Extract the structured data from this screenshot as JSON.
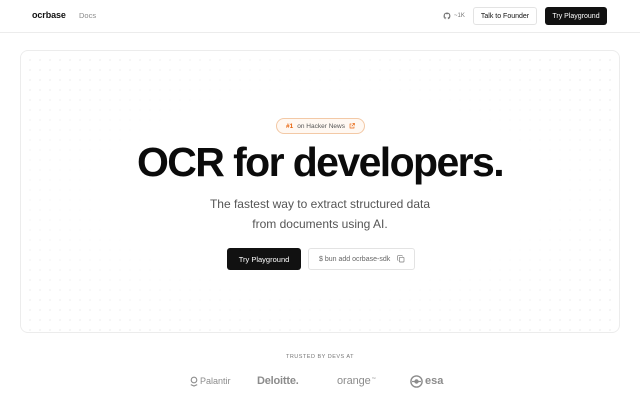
{
  "header": {
    "brand": "ocrbase",
    "nav": [
      {
        "label": "Docs"
      }
    ],
    "github_stars": "~1K",
    "talk_button": "Talk to Founder",
    "try_button": "Try Playground"
  },
  "hero": {
    "badge_rank": "#1",
    "badge_text": "on Hacker News",
    "headline": "OCR for developers.",
    "subhead_line1": "The fastest way to extract structured data",
    "subhead_line2": "from documents using AI.",
    "primary_button": "Try Playground",
    "install_command": "$ bun add ocrbase-sdk"
  },
  "trusted": {
    "label": "TRUSTED BY DEVS AT",
    "logos": [
      {
        "name": "Palantir"
      },
      {
        "name": "Deloitte."
      },
      {
        "name": "orange",
        "mark": "™"
      },
      {
        "name": "esa"
      }
    ]
  },
  "colors": {
    "accent_dark": "#111111",
    "hn_orange": "#e8640c",
    "badge_border": "#f3c9a6",
    "muted_text": "#8a8a8a"
  },
  "icons": [
    "github-icon",
    "external-link-icon",
    "copy-icon",
    "palantir-icon",
    "esa-icon"
  ]
}
